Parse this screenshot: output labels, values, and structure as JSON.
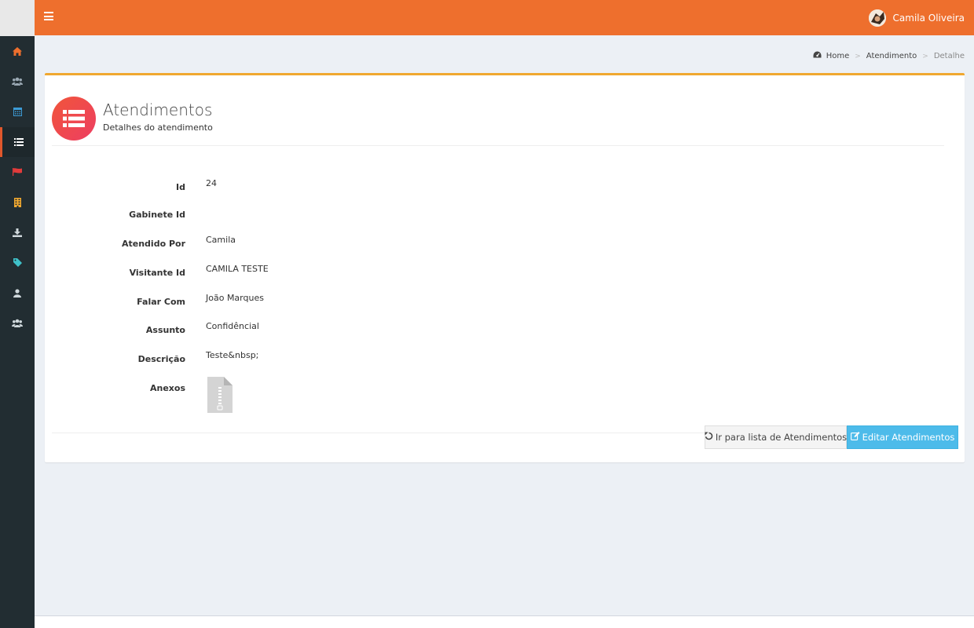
{
  "header": {
    "user_name": "Camila Oliveira",
    "accent_color": "#ee6f2d"
  },
  "sidebar": {
    "items": [
      {
        "icon": "home-icon",
        "color": "#ee6f2d"
      },
      {
        "icon": "users-icon",
        "color": "#9aa8b3"
      },
      {
        "icon": "calendar-icon",
        "color": "#3c9bd6"
      },
      {
        "icon": "list-icon",
        "color": "#ffffff",
        "active": true
      },
      {
        "icon": "flag-icon",
        "color": "#e23b3b"
      },
      {
        "icon": "building-icon",
        "color": "#f0a830"
      },
      {
        "icon": "download-icon",
        "color": "#cfd8dc"
      },
      {
        "icon": "tag-icon",
        "color": "#3fc1c9"
      },
      {
        "icon": "user-icon",
        "color": "#cfd8dc"
      },
      {
        "icon": "group-icon",
        "color": "#cfd8dc"
      }
    ]
  },
  "breadcrumb": {
    "home": "Home",
    "section": "Atendimento",
    "current": "Detalhe"
  },
  "page": {
    "title": "Atendimentos",
    "subtitle": "Detalhes do atendimento"
  },
  "details": [
    {
      "label": "Id",
      "value": "24"
    },
    {
      "label": "Gabinete Id",
      "value": ""
    },
    {
      "label": "Atendido Por",
      "value": "Camila"
    },
    {
      "label": "Visitante Id",
      "value": "CAMILA TESTE"
    },
    {
      "label": "Falar Com",
      "value": "João Marques"
    },
    {
      "label": "Assunto",
      "value": "Confidêncial"
    },
    {
      "label": "Descrição",
      "value": "Teste&nbsp;"
    },
    {
      "label": "Anexos",
      "value": ""
    }
  ],
  "attachment": {
    "icon": "zip-file-icon"
  },
  "actions": {
    "back_label": "Ir para lista de Atendimentos",
    "edit_label": "Editar Atendimentos"
  }
}
